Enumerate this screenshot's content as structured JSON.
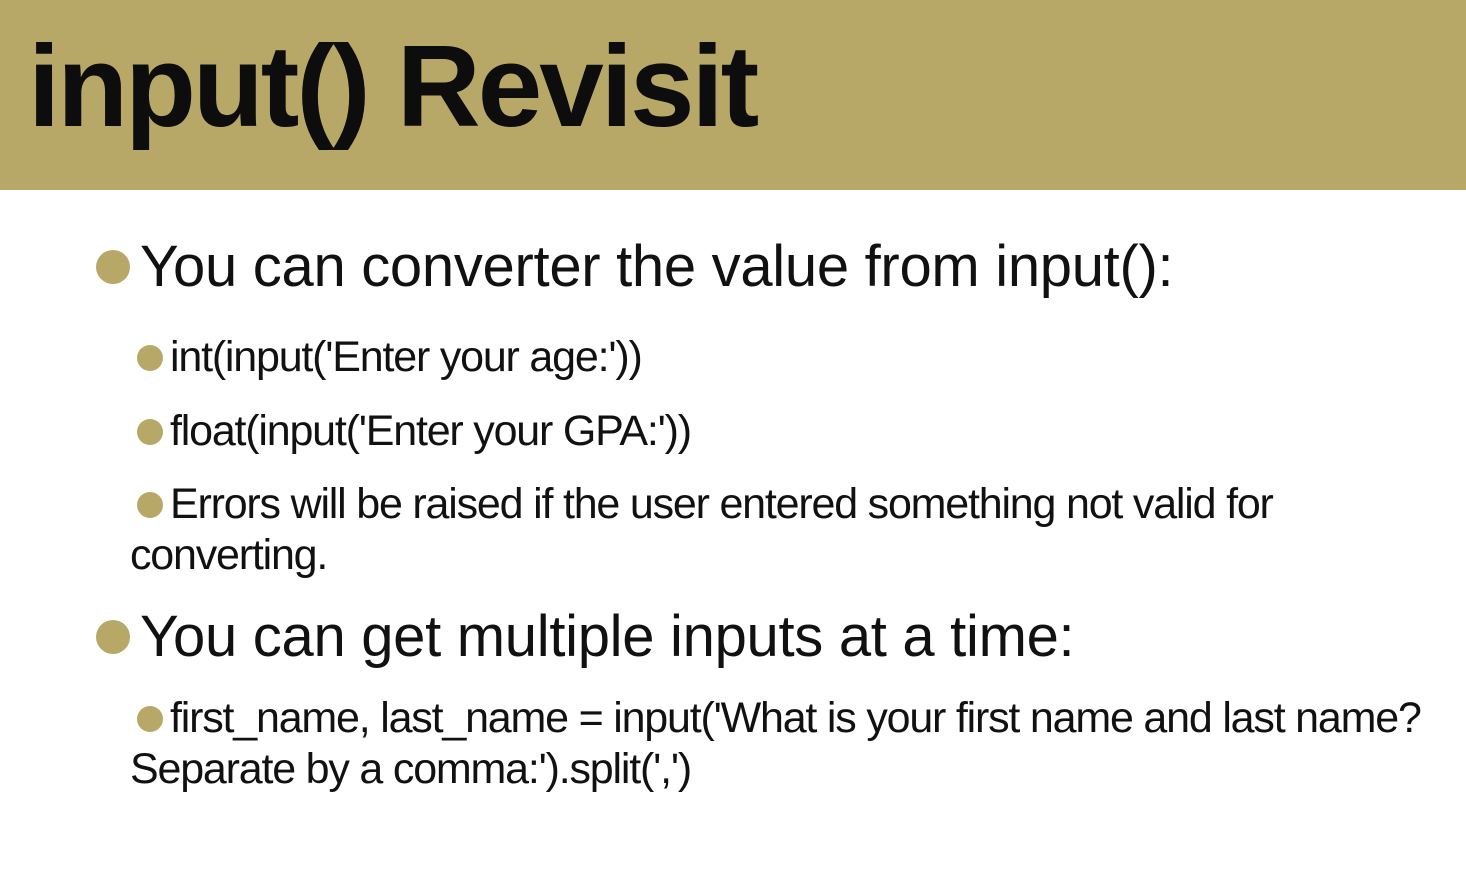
{
  "slide": {
    "title": "input() Revisit",
    "bullets": [
      {
        "text": "You can converter the value from input():",
        "subitems": [
          "int(input('Enter your age:'))",
          "float(input('Enter your GPA:'))",
          "Errors will be raised if the user entered something not valid for converting."
        ]
      },
      {
        "text": "You can get multiple inputs at a time:",
        "subitems": [
          "first_name, last_name = input('What is your first name and last name? Separate by a comma:').split(',')"
        ]
      }
    ]
  },
  "colors": {
    "accent": "#b8a868",
    "text": "#111111",
    "background": "#ffffff"
  }
}
